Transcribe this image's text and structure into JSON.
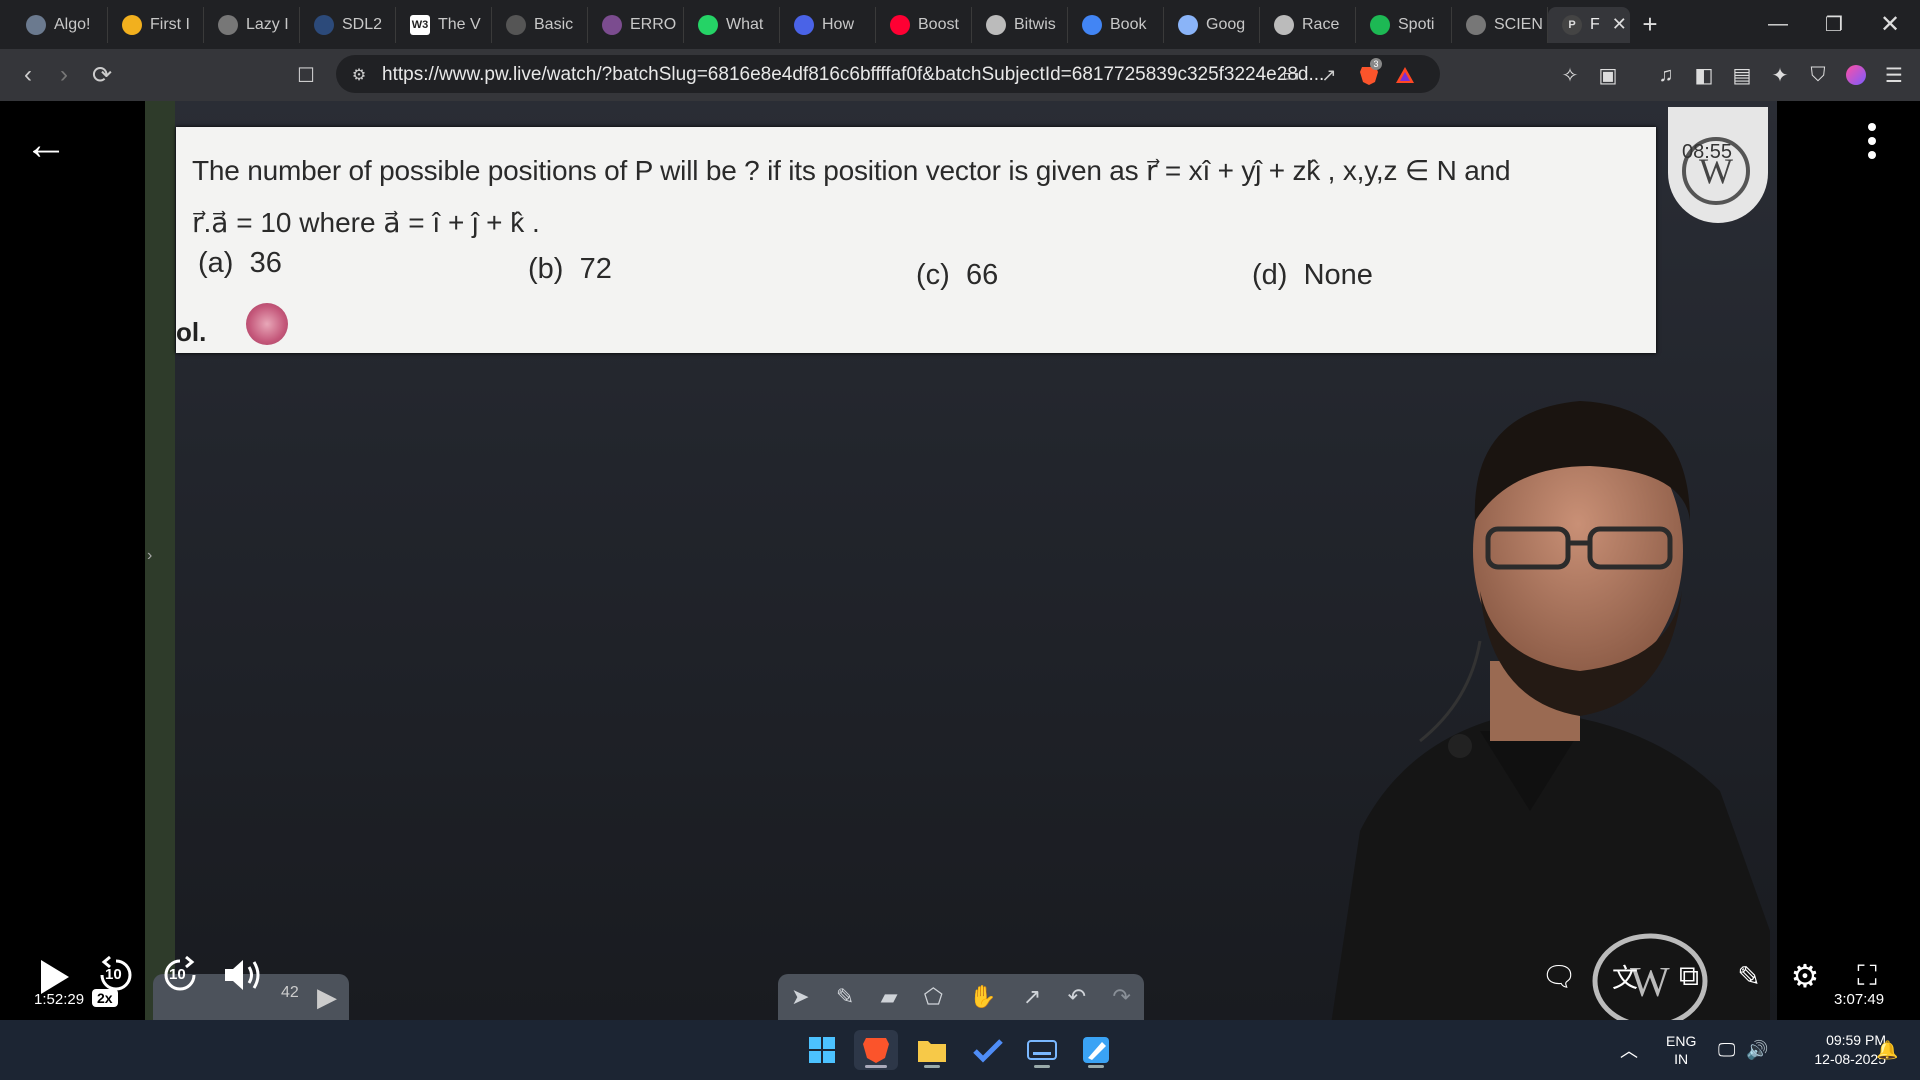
{
  "tabs": [
    {
      "label": "Algo!",
      "icon": "algo-icon",
      "color": "#6b7a8f"
    },
    {
      "label": "First I",
      "icon": "first-icon",
      "color": "#f2b01e"
    },
    {
      "label": "Lazy I",
      "icon": "globe-icon",
      "color": "#777"
    },
    {
      "label": "SDL2",
      "icon": "sdl-icon",
      "color": "#2c4a7a"
    },
    {
      "label": "The V",
      "icon": "w3-icon",
      "color": "#fff"
    },
    {
      "label": "Basic",
      "icon": "html-icon",
      "color": "#555"
    },
    {
      "label": "ERRO",
      "icon": "error-icon",
      "color": "#7b4c8f"
    },
    {
      "label": "What",
      "icon": "whatsapp-icon",
      "color": "#25d366"
    },
    {
      "label": "How",
      "icon": "how-icon",
      "color": "#4a63e7"
    },
    {
      "label": "Boost",
      "icon": "youtube-icon",
      "color": "#ff0033"
    },
    {
      "label": "Bitwis",
      "icon": "code-icon",
      "color": "#bbb"
    },
    {
      "label": "Book",
      "icon": "google-icon",
      "color": "#4285f4"
    },
    {
      "label": "Goog",
      "icon": "gemini-icon",
      "color": "#8ab4f8"
    },
    {
      "label": "Race",
      "icon": "openai-icon",
      "color": "#bbb"
    },
    {
      "label": "Spoti",
      "icon": "spotify-icon",
      "color": "#1db954"
    },
    {
      "label": "SCIEN",
      "icon": "globe-icon",
      "color": "#777"
    }
  ],
  "active_tab": {
    "label": "F",
    "icon": "pw-icon"
  },
  "address_bar": {
    "url": "https://www.pw.live/watch/?batchSlug=6816e8e4df816c6bffffaf0f&batchSubjectId=6817725839c325f3224e28d...",
    "brave_badge": "3"
  },
  "question": {
    "line1": "The number of possible positions of P will be ? if its position vector is given as  r⃗ = xî + yĵ + zk̂ ,  x,y,z ∈ N  and",
    "line2": "r⃗.a⃗ = 10  where  a⃗ = î + ĵ + k̂ .",
    "options": [
      {
        "key": "(a)",
        "value": "36"
      },
      {
        "key": "(b)",
        "value": "72"
      },
      {
        "key": "(c)",
        "value": "66"
      },
      {
        "key": "(d)",
        "value": "None"
      }
    ],
    "sol_label": "ol."
  },
  "watermark": {
    "timestamp": "08:55",
    "logo_text": "W"
  },
  "player": {
    "current_time": "1:52:29",
    "speed": "2x",
    "total_time": "3:07:49",
    "progress_fraction": 0.6,
    "skip_back": "10",
    "skip_forward": "10",
    "board_number": "42"
  },
  "taskbar": {
    "lang_top": "ENG",
    "lang_bottom": "IN",
    "time": "09:59 PM",
    "date": "12-08-2025"
  }
}
